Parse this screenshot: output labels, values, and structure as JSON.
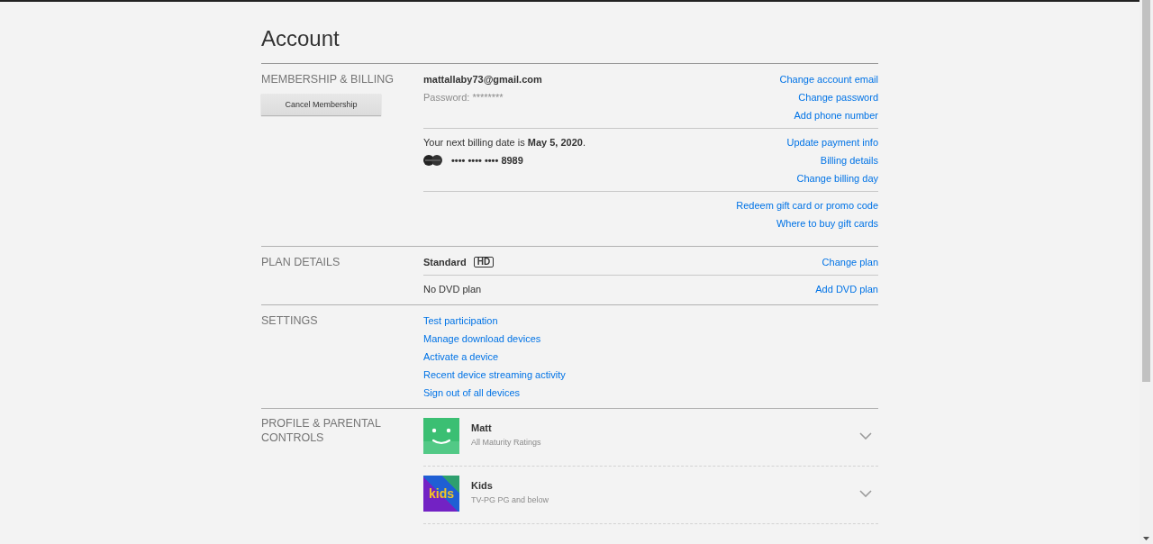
{
  "title": "Account",
  "sections": [
    {
      "kind": "blocks",
      "heading": "MEMBERSHIP & BILLING",
      "button": "Cancel Membership",
      "blocks": [
        {
          "lines": [
            {
              "kind": "email",
              "text": "mattallaby73@gmail.com"
            },
            {
              "kind": "password",
              "text": "Password: ********"
            }
          ],
          "links": [
            "Change account email",
            "Change password",
            "Add phone number"
          ]
        },
        {
          "lines": [
            {
              "kind": "billing",
              "text": "Your next billing date is **May 5, 2020**."
            },
            {
              "kind": "card",
              "text": "•••• •••• •••• 8989"
            }
          ],
          "links": [
            "Update payment info",
            "Billing details",
            "Change billing day"
          ]
        },
        {
          "links": [
            "Redeem gift card or promo code",
            "Where to buy gift cards"
          ]
        }
      ]
    },
    {
      "kind": "blocks",
      "heading": "PLAN DETAILS",
      "blocks": [
        {
          "lines": [
            {
              "kind": "plan",
              "text": "Standard",
              "badge": "HD"
            }
          ],
          "links": [
            "Change plan"
          ]
        },
        {
          "lines": [
            {
              "kind": "plain",
              "text": "No DVD plan"
            }
          ],
          "links": [
            "Add DVD plan"
          ]
        }
      ]
    },
    {
      "kind": "links",
      "heading": "SETTINGS",
      "links": [
        "Test participation",
        "Manage download devices",
        "Activate a device",
        "Recent device streaming activity",
        "Sign out of all devices"
      ]
    },
    {
      "kind": "profiles",
      "heading": "PROFILE & PARENTAL CONTROLS",
      "profiles": [
        {
          "kind": "smile",
          "name": "Matt",
          "rating": "All Maturity Ratings"
        },
        {
          "kind": "kids",
          "avatar_text": "kids",
          "name": "Kids",
          "rating": "TV-PG PG and below"
        }
      ]
    }
  ]
}
